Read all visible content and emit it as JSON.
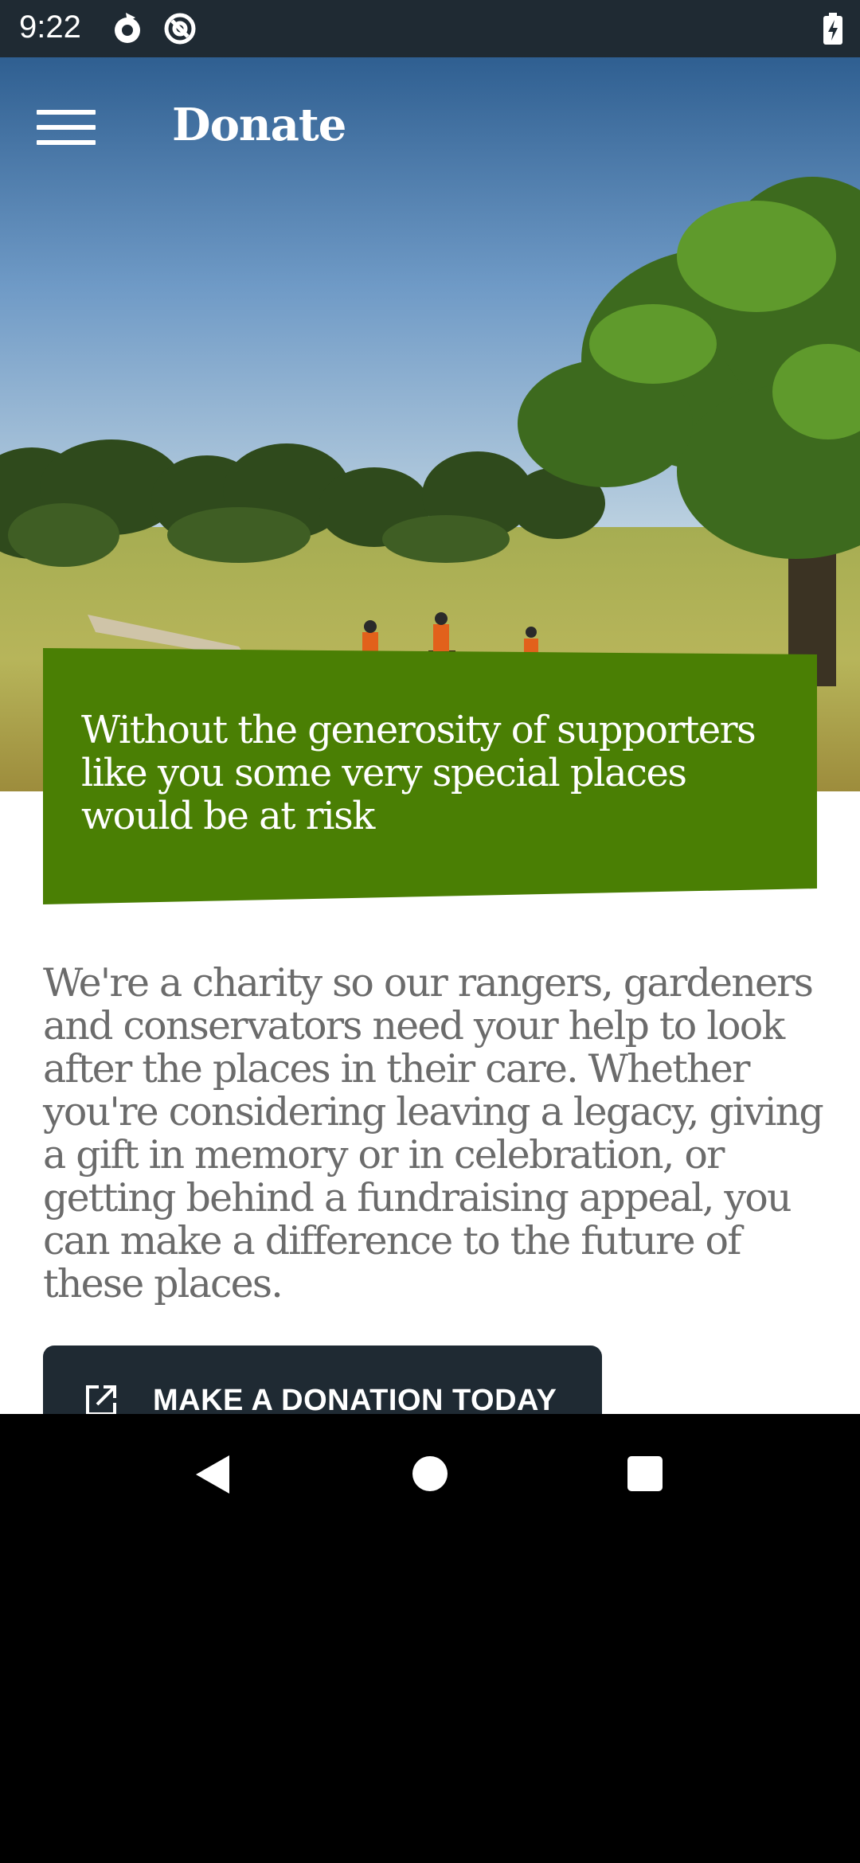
{
  "status_bar": {
    "time": "9:22",
    "icons": [
      "sync-icon",
      "at-sign-icon",
      "battery-charging-icon"
    ]
  },
  "app_bar": {
    "title": "Donate",
    "menu_icon": "hamburger-menu-icon"
  },
  "hero": {
    "image_description_icon": "countryside-riders-image",
    "callout_text": "Without the generosity of supporters like you some very special places would be at risk",
    "callout_color": "#4a7f04"
  },
  "intro": {
    "paragraph": "We're a charity so our rangers, gardeners and conservators need your help to look after the places in their care. Whether you're considering leaving a legacy, giving a gift in memory or in celebration, or getting behind a fundraising appeal, you can make a difference to the future of these places."
  },
  "donate_button": {
    "label": "MAKE A DONATION TODAY",
    "icon": "external-link-icon",
    "color": "#1f2a33"
  },
  "nav_bar": {
    "back": "back-icon",
    "home": "home-icon",
    "recents": "recents-icon"
  }
}
